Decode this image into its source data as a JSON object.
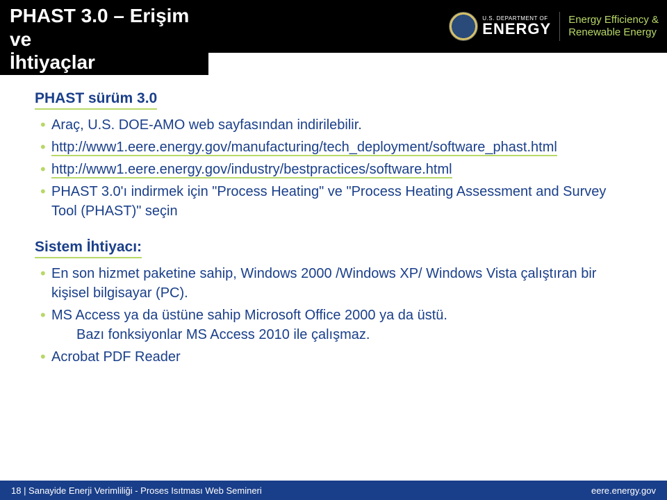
{
  "header": {
    "title_line1": "PHAST 3.0 – Erişim ve",
    "title_line2": "İhtiyaçlar",
    "doe_small": "U.S. DEPARTMENT OF",
    "doe_big": "ENERGY",
    "eere_line1": "Energy Efficiency &",
    "eere_line2": "Renewable Energy"
  },
  "section1": {
    "heading": "PHAST sürüm 3.0",
    "items": [
      "Araç, U.S. DOE-AMO web sayfasından indirilebilir.",
      "http://www1.eere.energy.gov/manufacturing/tech_deployment/software_phast.html",
      "http://www1.eere.energy.gov/industry/bestpractices/software.html",
      "PHAST 3.0'ı indirmek için \"Process Heating\" ve \"Process Heating Assessment and Survey Tool (PHAST)\" seçin"
    ]
  },
  "section2": {
    "heading": "Sistem İhtiyacı:",
    "items": [
      "En son hizmet paketine sahip, Windows 2000 /Windows XP/ Windows Vista çalıştıran bir kişisel bilgisayar (PC).",
      "MS Access ya da üstüne sahip Microsoft Office 2000 ya da üstü.",
      "Acrobat PDF Reader"
    ],
    "note_indent": "Bazı fonksiyonlar MS Access 2010 ile çalışmaz."
  },
  "footer": {
    "left": "18 | Sanayide Enerji Verimliliği  - Proses Isıtması Web Semineri",
    "right": "eere.energy.gov"
  }
}
